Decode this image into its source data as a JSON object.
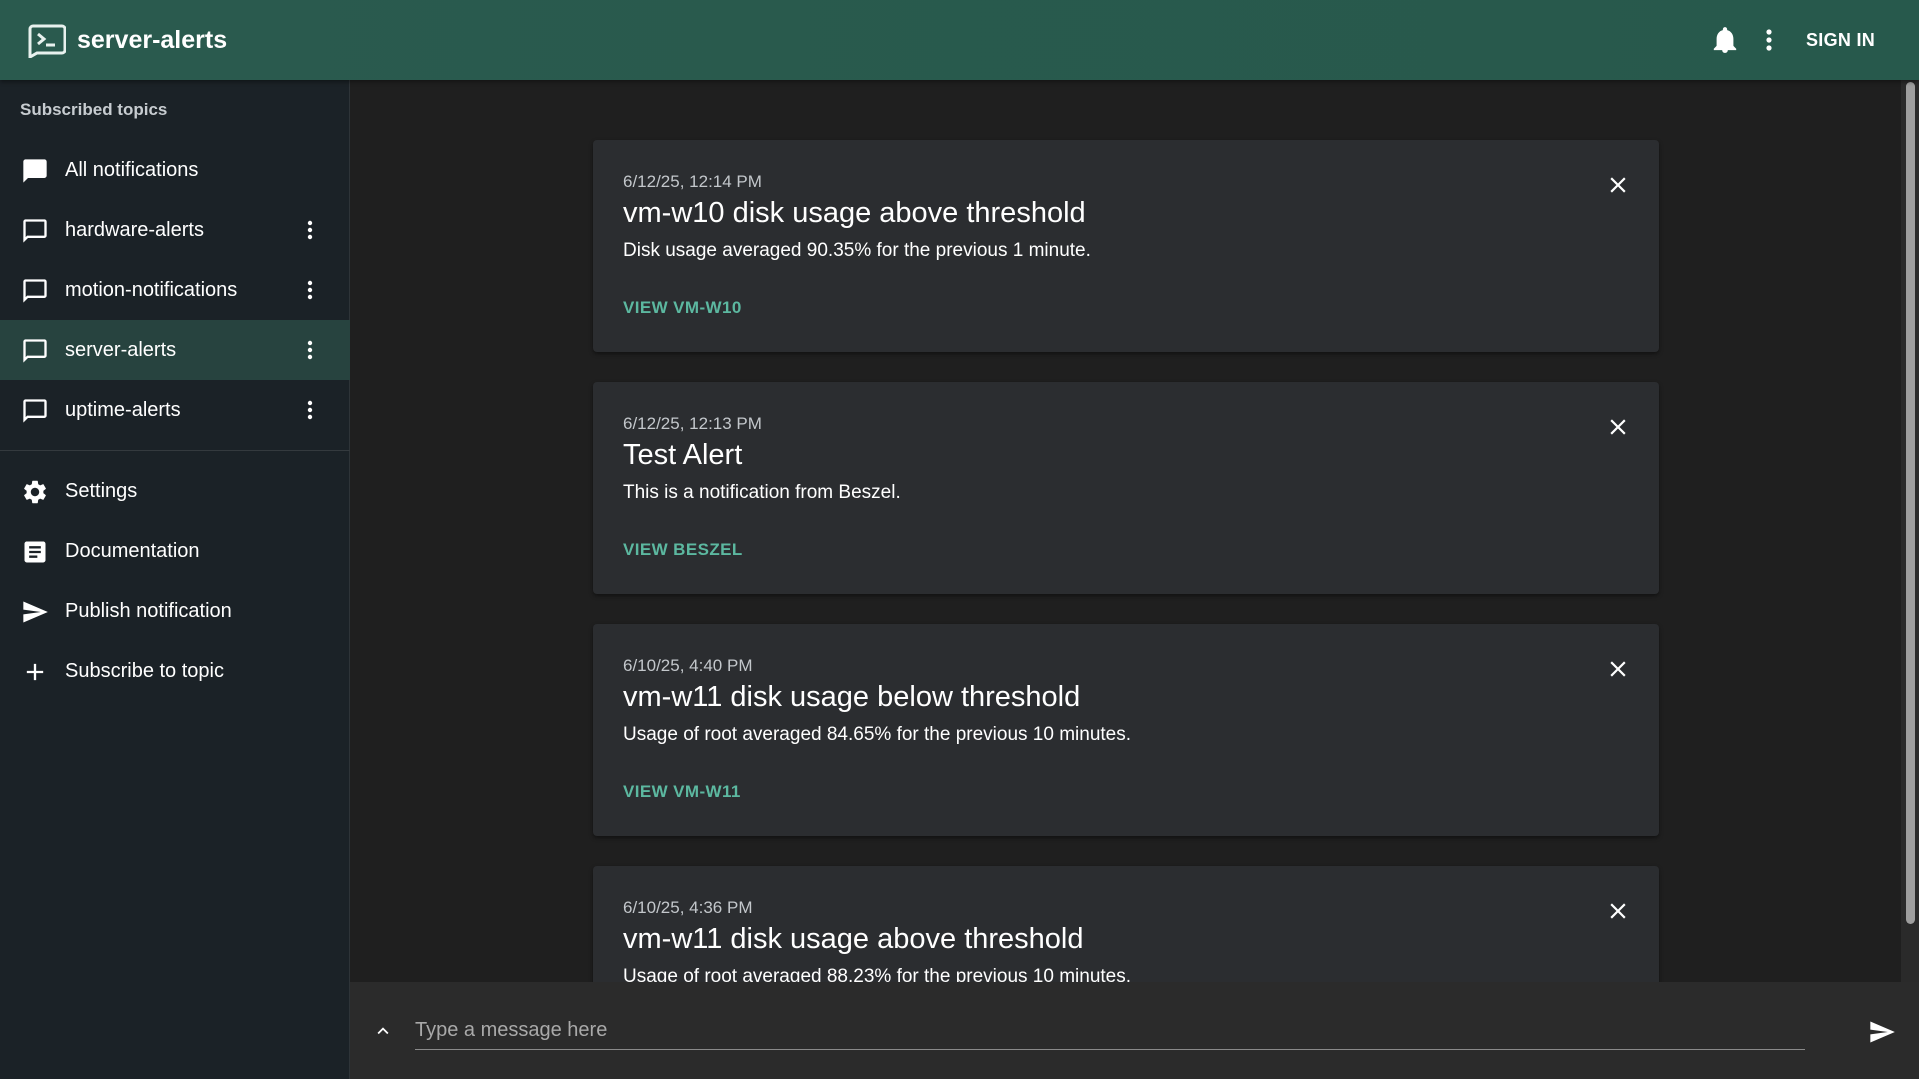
{
  "app": {
    "title": "server-alerts",
    "icon": "terminal-logo-icon"
  },
  "topbar": {
    "bell_icon": "bell-icon",
    "more_icon": "more-vert-icon",
    "signin_label": "SIGN IN"
  },
  "sidebar": {
    "header": "Subscribed topics",
    "topics": [
      {
        "label": "All notifications",
        "icon": "chat-filled-icon",
        "has_menu": false,
        "active": false
      },
      {
        "label": "hardware-alerts",
        "icon": "chat-outline-icon",
        "has_menu": true,
        "active": false
      },
      {
        "label": "motion-notifications",
        "icon": "chat-outline-icon",
        "has_menu": true,
        "active": false
      },
      {
        "label": "server-alerts",
        "icon": "chat-outline-icon",
        "has_menu": true,
        "active": true
      },
      {
        "label": "uptime-alerts",
        "icon": "chat-outline-icon",
        "has_menu": true,
        "active": false
      }
    ],
    "links": [
      {
        "label": "Settings",
        "icon": "gear-icon"
      },
      {
        "label": "Documentation",
        "icon": "document-icon"
      },
      {
        "label": "Publish notification",
        "icon": "send-icon"
      },
      {
        "label": "Subscribe to topic",
        "icon": "plus-icon"
      }
    ]
  },
  "notifications": [
    {
      "time": "6/12/25, 12:14 PM",
      "title": "vm-w10 disk usage above threshold",
      "body": "Disk usage averaged 90.35% for the previous 1 minute.",
      "action": "VIEW VM-W10"
    },
    {
      "time": "6/12/25, 12:13 PM",
      "title": "Test Alert",
      "body": "This is a notification from Beszel.",
      "action": "VIEW BESZEL"
    },
    {
      "time": "6/10/25, 4:40 PM",
      "title": "vm-w11 disk usage below threshold",
      "body": "Usage of root averaged 84.65% for the previous 10 minutes.",
      "action": "VIEW VM-W11"
    },
    {
      "time": "6/10/25, 4:36 PM",
      "title": "vm-w11 disk usage above threshold",
      "body": "Usage of root averaged 88.23% for the previous 10 minutes.",
      "action": ""
    }
  ],
  "composer": {
    "placeholder": "Type a message here",
    "expand_icon": "chevron-up-icon",
    "send_icon": "send-icon"
  },
  "colors": {
    "topbar": "#27594c",
    "accent": "#5cb8a0",
    "sidebar": "#1b2227",
    "card": "#2b2d30",
    "active_item": "#27433f"
  }
}
